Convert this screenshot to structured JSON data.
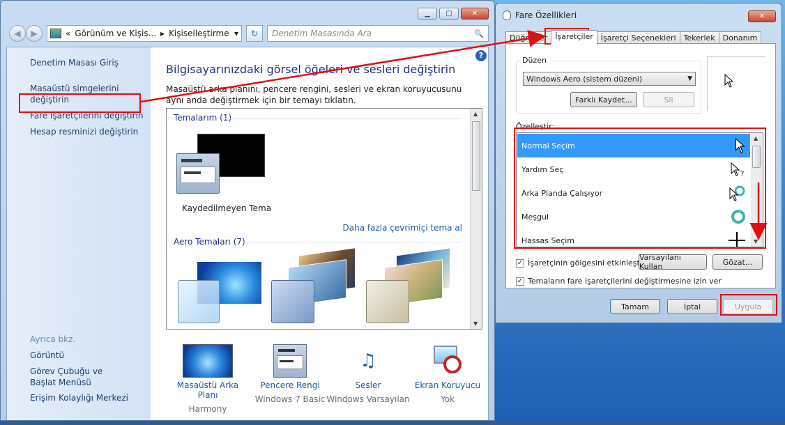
{
  "control_panel": {
    "breadcrumb": {
      "prefix": "«",
      "parent": "Görünüm ve Kişis...",
      "separator": "▸",
      "current": "Kişiselleştirme"
    },
    "search_placeholder": "Denetim Masasında Ara",
    "left_pane": {
      "home": "Denetim Masası Giriş",
      "links": [
        "Masaüstü simgelerini değiştirin",
        "Fare işaretçilerini değiştirin",
        "Hesap resminizi değiştirin"
      ],
      "see_also_title": "Ayrıca bkz.",
      "see_also": [
        "Görüntü",
        "Görev Çubuğu ve Başlat Menüsü",
        "Erişim Kolaylığı Merkezi"
      ]
    },
    "main": {
      "heading": "Bilgisayarınızdaki görsel öğeleri ve sesleri değiştirin",
      "description": "Masaüstü arka planını, pencere rengini, sesleri ve ekran koruyucusunu aynı anda değiştirmek için bir temayı tıklatın.",
      "my_themes_group": "Temalarım (1)",
      "unsaved_theme": "Kaydedilmeyen Tema",
      "get_more_link": "Daha fazla çevrimiçi tema al",
      "aero_group": "Aero Temaları (7)"
    },
    "bottom_items": [
      {
        "label": "Masaüstü Arka Planı",
        "value": "Harmony"
      },
      {
        "label": "Pencere Rengi",
        "value": "Windows 7 Basic"
      },
      {
        "label": "Sesler",
        "value": "Windows Varsayılan"
      },
      {
        "label": "Ekran Koruyucu",
        "value": "Yok"
      }
    ]
  },
  "mouse_dialog": {
    "title": "Fare Özellikleri",
    "tabs": [
      "Düğmeler",
      "İşaretçiler",
      "İşaretçi Seçenekleri",
      "Tekerlek",
      "Donanım"
    ],
    "active_tab": "İşaretçiler",
    "scheme_label": "Düzen",
    "scheme_value": "Windows Aero (sistem düzeni)",
    "save_as_button": "Farklı Kaydet...",
    "delete_button": "Sil",
    "customize_label": "Özelleştir:",
    "cursors": [
      {
        "name": "Normal Seçim",
        "icon": "arrow-cursor-icon",
        "selected": true
      },
      {
        "name": "Yardım Seç",
        "icon": "help-cursor-icon",
        "selected": false
      },
      {
        "name": "Arka Planda Çalışıyor",
        "icon": "working-in-background-cursor-icon",
        "selected": false
      },
      {
        "name": "Meşgul",
        "icon": "busy-cursor-icon",
        "selected": false
      },
      {
        "name": "Hassas Seçim",
        "icon": "crosshair-cursor-icon",
        "selected": false
      }
    ],
    "shadow_checkbox": "İşaretçinin gölgesini etkinleştir",
    "shadow_checked": true,
    "use_default_button": "Varsayılanı Kullan",
    "browse_button": "Gözat...",
    "allow_themes_checkbox": "Temaların fare işaretçilerini değiştirmesine izin ver",
    "allow_themes_checked": true,
    "ok_button": "Tamam",
    "cancel_button": "İptal",
    "apply_button": "Uygula",
    "close_glyph": "✕"
  },
  "window_glyphs": {
    "minimize": "▁",
    "maximize": "▢",
    "close": "✕",
    "back": "◀",
    "forward": "▶",
    "dropdown": "▾",
    "refresh": "↻",
    "search": "🔍",
    "help": "?"
  },
  "colors": {
    "selection": "#3399ff",
    "annotation": "#e01010",
    "link": "#1e5aa8",
    "heading": "#1e3287"
  }
}
